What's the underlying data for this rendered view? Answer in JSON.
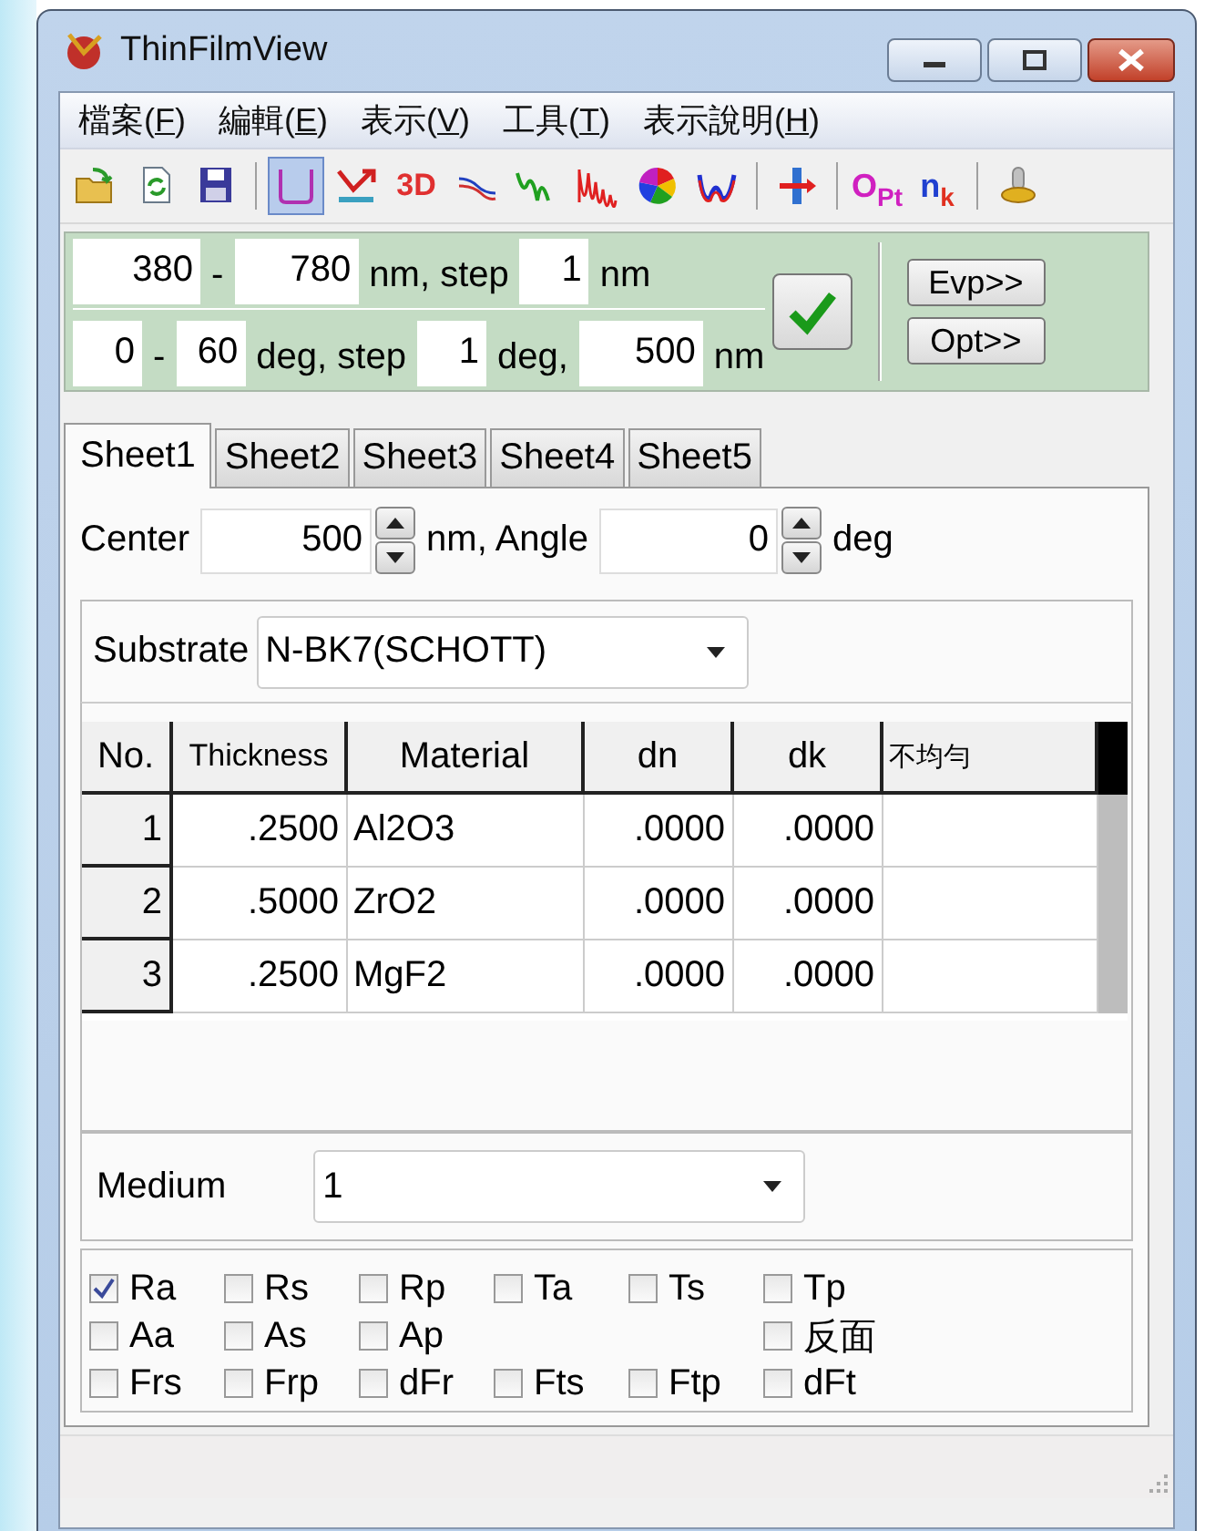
{
  "window": {
    "title": "ThinFilmView"
  },
  "menu": [
    {
      "before": "檔案(",
      "key": "F",
      "after": ")"
    },
    {
      "before": "編輯(",
      "key": "E",
      "after": ")"
    },
    {
      "before": "表示(",
      "key": "V",
      "after": ")"
    },
    {
      "before": "工具(",
      "key": "T",
      "after": ")"
    },
    {
      "before": "表示說明(",
      "key": "H",
      "after": ")"
    }
  ],
  "toolbar": [
    {
      "kind": "open",
      "selected": false
    },
    {
      "kind": "reload",
      "selected": false
    },
    {
      "kind": "save",
      "selected": false
    },
    {
      "kind": "sep"
    },
    {
      "kind": "curve",
      "selected": true
    },
    {
      "kind": "arrow",
      "selected": false
    },
    {
      "kind": "text",
      "text": "3D",
      "selected": false
    },
    {
      "kind": "lines",
      "selected": false
    },
    {
      "kind": "peaks",
      "selected": false
    },
    {
      "kind": "waves",
      "selected": false
    },
    {
      "kind": "colorwheel",
      "selected": false
    },
    {
      "kind": "wcurve",
      "selected": false
    },
    {
      "kind": "sep"
    },
    {
      "kind": "split",
      "selected": false
    },
    {
      "kind": "sep"
    },
    {
      "kind": "sub",
      "main": "O",
      "sub": "Pt",
      "selected": false
    },
    {
      "kind": "sub",
      "main": "n",
      "sub": "k",
      "selected": false
    },
    {
      "kind": "sep"
    },
    {
      "kind": "probe",
      "selected": false
    }
  ],
  "range_rows": [
    [
      {
        "kind": "field",
        "value": "380"
      },
      {
        "kind": "label",
        "text": "-"
      },
      {
        "kind": "field",
        "value": "780"
      },
      {
        "kind": "label",
        "text": "nm, step"
      },
      {
        "kind": "field",
        "value": "1"
      },
      {
        "kind": "label",
        "text": "nm"
      }
    ],
    [
      {
        "kind": "field",
        "value": "0"
      },
      {
        "kind": "label",
        "text": "-"
      },
      {
        "kind": "field",
        "value": "60"
      },
      {
        "kind": "label",
        "text": "deg, step"
      },
      {
        "kind": "field",
        "value": "1"
      },
      {
        "kind": "label",
        "text": "deg,"
      },
      {
        "kind": "field",
        "value": "500"
      },
      {
        "kind": "label",
        "text": "nm"
      }
    ]
  ],
  "side_buttons": [
    "Evp>>",
    "Opt>>"
  ],
  "tabs": [
    {
      "label": "Sheet1",
      "selected": true
    },
    {
      "label": "Sheet2",
      "selected": false
    },
    {
      "label": "Sheet3",
      "selected": false
    },
    {
      "label": "Sheet4",
      "selected": false
    },
    {
      "label": "Sheet5",
      "selected": false
    }
  ],
  "center": {
    "label": "Center",
    "value": "500",
    "unit": "nm, Angle",
    "angle": "0",
    "angle_unit": "deg"
  },
  "substrate": {
    "label": "Substrate",
    "value": "N-BK7(SCHOTT)"
  },
  "table": {
    "columns": [
      "No.",
      "Thickness",
      "Material",
      "dn",
      "dk",
      "不均勻"
    ],
    "rows": [
      [
        "1",
        ".2500",
        "Al2O3",
        ".0000",
        ".0000",
        ""
      ],
      [
        "2",
        ".5000",
        "ZrO2",
        ".0000",
        ".0000",
        ""
      ],
      [
        "3",
        ".2500",
        "MgF2",
        ".0000",
        ".0000",
        ""
      ]
    ]
  },
  "medium": {
    "label": "Medium",
    "value": "1"
  },
  "outputs": [
    [
      {
        "label": "Ra",
        "checked": true
      },
      {
        "label": "Rs",
        "checked": false
      },
      {
        "label": "Rp",
        "checked": false
      },
      {
        "label": "Ta",
        "checked": false
      },
      {
        "label": "Ts",
        "checked": false
      },
      {
        "label": "Tp",
        "checked": false
      }
    ],
    [
      {
        "label": "Aa",
        "checked": false
      },
      {
        "label": "As",
        "checked": false
      },
      {
        "label": "Ap",
        "checked": false
      }
    ],
    [
      {
        "label": "Frs",
        "checked": false
      },
      {
        "label": "Frp",
        "checked": false
      },
      {
        "label": "dFr",
        "checked": false
      },
      {
        "label": "Fts",
        "checked": false
      },
      {
        "label": "Ftp",
        "checked": false
      },
      {
        "label": "dFt",
        "checked": false
      }
    ]
  ],
  "reverse": {
    "label": "反面",
    "checked": false
  }
}
